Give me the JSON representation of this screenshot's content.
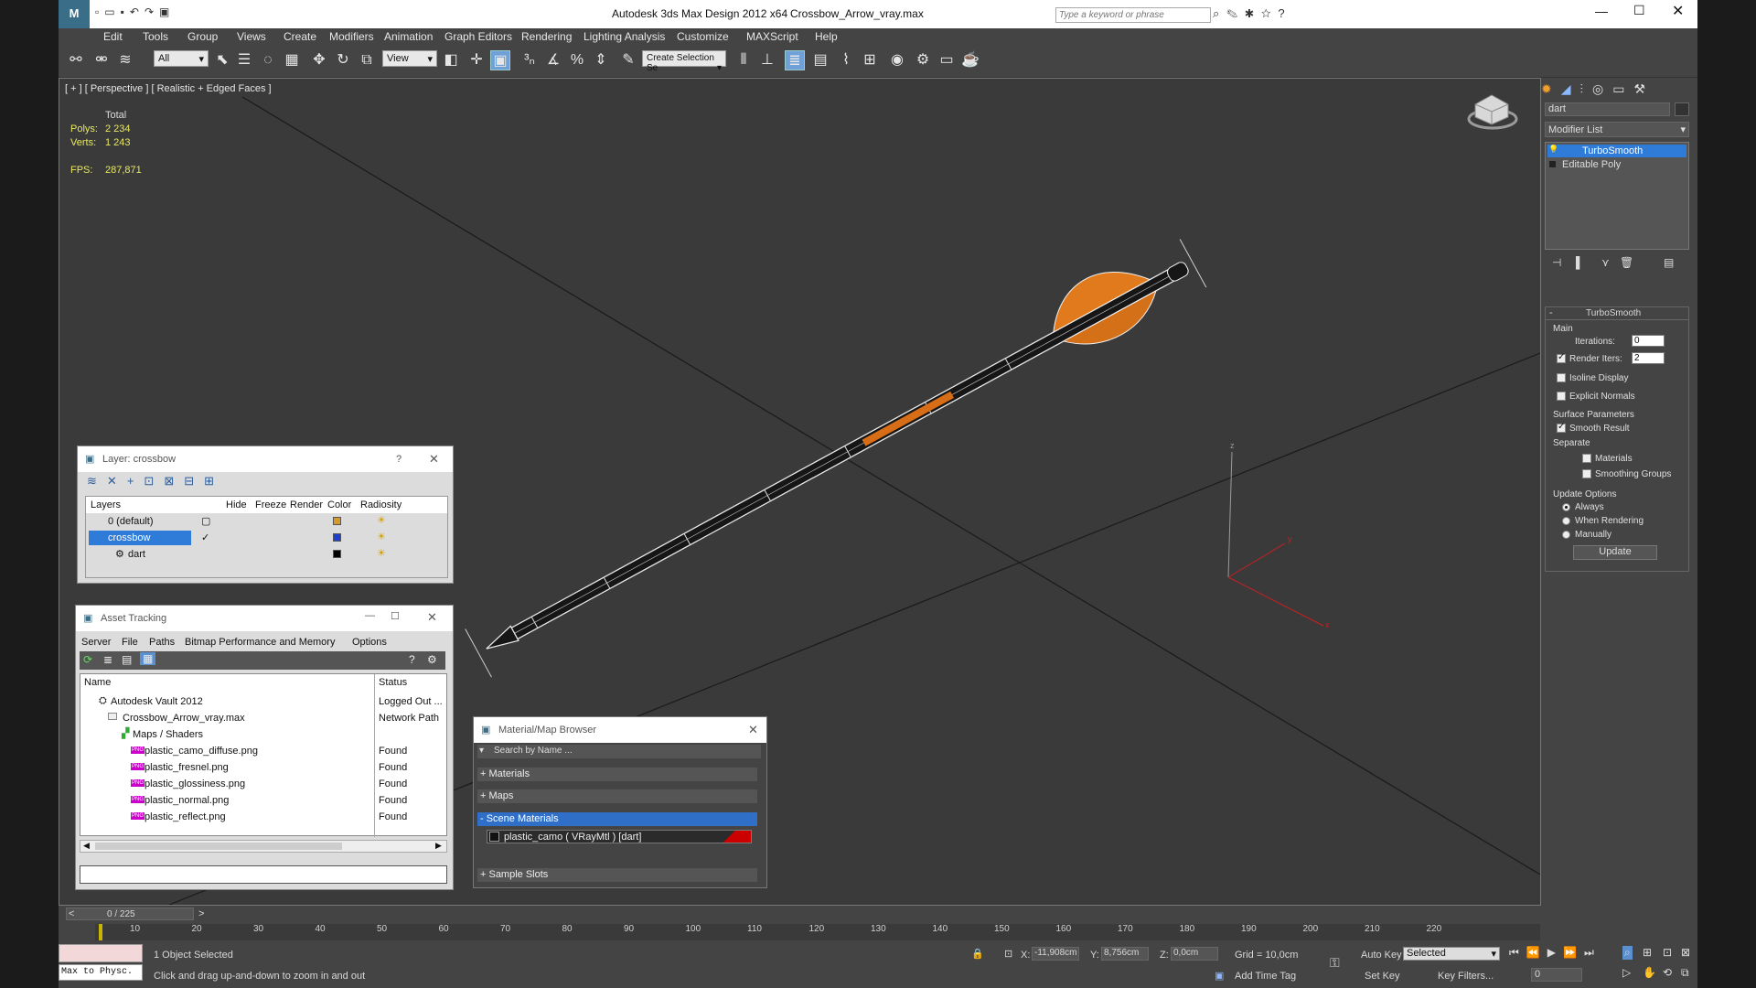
{
  "title": {
    "app": "Autodesk 3ds Max Design 2012 x64",
    "file": "Crossbow_Arrow_vray.max"
  },
  "search": {
    "placeholder": "Type a keyword or phrase"
  },
  "menu": [
    "Edit",
    "Tools",
    "Group",
    "Views",
    "Create",
    "Modifiers",
    "Animation",
    "Graph Editors",
    "Rendering",
    "Lighting Analysis",
    "Customize",
    "MAXScript",
    "Help"
  ],
  "toolbar": {
    "selection_filter": "All",
    "ref_coord": "View",
    "selection_set": "Create Selection Se"
  },
  "viewport": {
    "label": "[ + ] [ Perspective ] [ Realistic + Edged Faces ]",
    "stats": {
      "total": "Total",
      "polys_label": "Polys:",
      "polys": "2 234",
      "verts_label": "Verts:",
      "verts": "1 243",
      "fps_label": "FPS:",
      "fps": "287,871"
    },
    "axis": {
      "x": "x",
      "y": "y",
      "z": "z"
    }
  },
  "layer_dialog": {
    "title": "Layer: crossbow",
    "help": "?",
    "columns": [
      "Layers",
      "Hide",
      "Freeze",
      "Render",
      "Color",
      "Radiosity"
    ],
    "rows": [
      {
        "name": "0 (default)",
        "color": "#d59a2a"
      },
      {
        "name": "crossbow",
        "color": "#1f3fd0"
      },
      {
        "name": "dart",
        "color": "#000000"
      }
    ]
  },
  "asset_tracking": {
    "title": "Asset Tracking",
    "menu": [
      "Server",
      "File",
      "Paths",
      "Bitmap Performance and Memory",
      "Options"
    ],
    "columns": [
      "Name",
      "Status"
    ],
    "rows": [
      {
        "name": "Autodesk Vault 2012",
        "status": "Logged Out ..."
      },
      {
        "name": "Crossbow_Arrow_vray.max",
        "status": "Network Path"
      },
      {
        "name": "Maps / Shaders",
        "status": ""
      },
      {
        "name": "plastic_camo_diffuse.png",
        "status": "Found"
      },
      {
        "name": "plastic_fresnel.png",
        "status": "Found"
      },
      {
        "name": "plastic_glossiness.png",
        "status": "Found"
      },
      {
        "name": "plastic_normal.png",
        "status": "Found"
      },
      {
        "name": "plastic_reflect.png",
        "status": "Found"
      }
    ],
    "file_badge": "PNG"
  },
  "material_browser": {
    "title": "Material/Map Browser",
    "search": "Search by Name ...",
    "sections": [
      "+ Materials",
      "+ Maps",
      "- Scene Materials",
      "+ Sample Slots"
    ],
    "material": "plastic_camo  ( VRayMtl )  [dart]"
  },
  "command_panel": {
    "object_name": "dart",
    "modifier_list": "Modifier List",
    "stack": [
      "TurboSmooth",
      "Editable Poly"
    ],
    "rollout": "TurboSmooth",
    "main": "Main",
    "iterations_label": "Iterations:",
    "iterations": "0",
    "render_iters_label": "Render Iters:",
    "render_iters": "2",
    "isoline": "Isoline Display",
    "explicit": "Explicit Normals",
    "surface": "Surface Parameters",
    "smooth": "Smooth Result",
    "separate": "Separate",
    "materials": "Materials",
    "smoothing": "Smoothing Groups",
    "update_options": "Update Options",
    "always": "Always",
    "when_rendering": "When Rendering",
    "manually": "Manually",
    "update": "Update"
  },
  "timeline": {
    "frame": "0 / 225",
    "ticks": [
      "10",
      "20",
      "30",
      "40",
      "50",
      "60",
      "70",
      "80",
      "90",
      "100",
      "110",
      "120",
      "130",
      "140",
      "150",
      "160",
      "170",
      "180",
      "190",
      "200",
      "210",
      "220"
    ]
  },
  "status": {
    "script_box": "Max to Physc.",
    "selected": "1 Object Selected",
    "prompt": "Click and drag up-and-down to zoom in and out",
    "x_label": "X:",
    "x": "-11,908cm",
    "y_label": "Y:",
    "y": "8,756cm",
    "z_label": "Z:",
    "z": "0,0cm",
    "grid": "Grid = 10,0cm",
    "add_time_tag": "Add Time Tag",
    "auto_key": "Auto Key",
    "selected_dd": "Selected",
    "set_key": "Set Key",
    "key_filters": "Key Filters...",
    "frame_field": "0"
  }
}
